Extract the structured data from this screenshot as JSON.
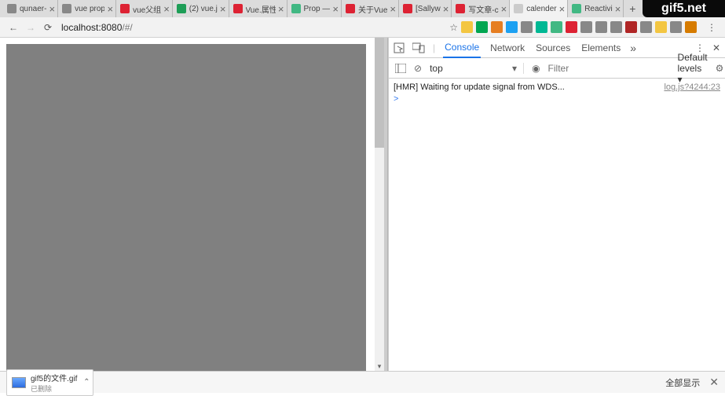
{
  "watermark": "gif5.net",
  "tabs": [
    {
      "label": "qunaer-",
      "fav": "#888",
      "active": false
    },
    {
      "label": "vue prop",
      "fav": "#888",
      "active": false
    },
    {
      "label": "vue父组",
      "fav": "#d23",
      "active": false
    },
    {
      "label": "(2) vue.j",
      "fav": "#1e9e57",
      "active": false
    },
    {
      "label": "Vue.属性",
      "fav": "#d23",
      "active": false
    },
    {
      "label": "Prop —",
      "fav": "#41b883",
      "active": false
    },
    {
      "label": "关于Vue",
      "fav": "#d23",
      "active": false
    },
    {
      "label": "[Sallyw",
      "fav": "#d23",
      "active": false
    },
    {
      "label": "写文章-c",
      "fav": "#d23",
      "active": false
    },
    {
      "label": "calender",
      "fav": "#ccc",
      "active": true
    },
    {
      "label": "Reactivi",
      "fav": "#41b883",
      "active": false
    }
  ],
  "newtab": "+",
  "nav": {
    "back": "←",
    "forward": "→",
    "reload": "⟳"
  },
  "url": {
    "host": "localhost:8080",
    "path": "/#/"
  },
  "ext_colors": [
    "#f3c642",
    "#00a651",
    "#e67e22",
    "#1da1f2",
    "#888",
    "#00b894",
    "#41b883",
    "#d23",
    "#888",
    "#888",
    "#888",
    "#b02626",
    "#888",
    "#f3c642",
    "#888",
    "#d67b00"
  ],
  "menu_dots": "⋮",
  "devtools": {
    "tabs": [
      "Console",
      "Network",
      "Sources",
      "Elements"
    ],
    "active": "Console",
    "more": "»",
    "close": "✕",
    "context": "top",
    "context_arrow": "▾",
    "filter_placeholder": "Filter",
    "levels": "Default levels ▾",
    "no_icon": "⊘",
    "eye_icon": "◉",
    "gear_icon": "⚙",
    "log": {
      "msg": "[HMR] Waiting for update signal from WDS...",
      "src": "log.js?4244:23"
    },
    "prompt": ">"
  },
  "download": {
    "file": "gif5的文件.gif",
    "status": "已删除",
    "chev": "⌃",
    "all": "全部显示",
    "close": "✕"
  }
}
